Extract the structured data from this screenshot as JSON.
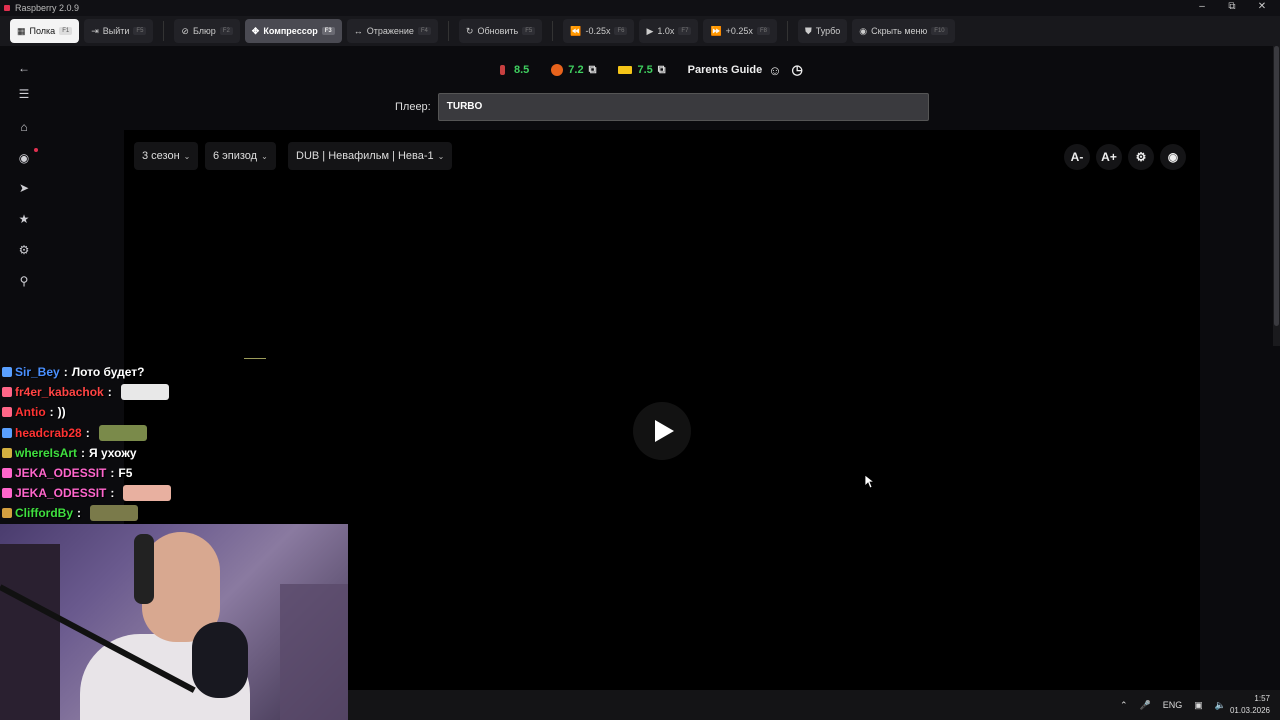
{
  "window": {
    "title": "Raspberry 2.0.9"
  },
  "toolbar": {
    "buttons": [
      {
        "label": "Полка",
        "key": "F1",
        "icon": "book-icon"
      },
      {
        "label": "Выйти",
        "key": "F5",
        "icon": "exit-icon"
      },
      {
        "label": "Блюр",
        "key": "F2",
        "icon": "blur-icon"
      },
      {
        "label": "Компрессор",
        "key": "F3",
        "icon": "compress-icon"
      },
      {
        "label": "Отражение",
        "key": "F4",
        "icon": "mirror-icon"
      },
      {
        "label": "Обновить",
        "key": "F5",
        "icon": "refresh-icon"
      },
      {
        "label": "-0.25x",
        "key": "F6",
        "icon": "rewind-icon"
      },
      {
        "label": "1.0x",
        "key": "F7",
        "icon": "play-icon"
      },
      {
        "label": "+0.25x",
        "key": "F8",
        "icon": "forward-icon"
      },
      {
        "label": "Турбо",
        "icon": "shield-icon"
      },
      {
        "label": "Скрыть меню",
        "key": "F10",
        "icon": "eye-icon"
      }
    ]
  },
  "ratings": {
    "kp": "8.5",
    "shikimori": "7.2",
    "imdb": "7.5",
    "parents_guide": "Parents Guide"
  },
  "player": {
    "label": "Плеер:",
    "value": "TURBO"
  },
  "video": {
    "season": "3 сезон",
    "episode": "6 эпизод",
    "dub": "DUB | Невафильм | Нева-1",
    "font_minus": "A-",
    "font_plus": "A+"
  },
  "chat": [
    {
      "user": "Sir_Bey",
      "color": "#4a90ff",
      "message": "Лото будет?",
      "badge": "#5aa0ff"
    },
    {
      "user": "fr4er_kabachok",
      "color": "#ff4444",
      "message": "",
      "badge": "#ff6688",
      "emote": "#e8e8e8"
    },
    {
      "user": "Antio",
      "color": "#ff3333",
      "message": "))",
      "badge": "#ff6688"
    },
    {
      "user": "headcrab28",
      "color": "#ff3333",
      "message": "",
      "badge": "#5aa0ff",
      "emote": "#7a8a4a"
    },
    {
      "user": "whereIsArt",
      "color": "#3fdf3f",
      "message": "Я ухожу",
      "badge": "#d4b040"
    },
    {
      "user": "JEKA_ODESSIT",
      "color": "#ff66cc",
      "message": "F5",
      "badge": "#ff66cc"
    },
    {
      "user": "JEKA_ODESSIT",
      "color": "#ff66cc",
      "message": "",
      "badge": "#ff66cc",
      "emote": "#e8b0a0"
    },
    {
      "user": "CliffordBy",
      "color": "#3fdf3f",
      "message": "",
      "badge": "#d4a040",
      "emote": "#7a7a4a"
    }
  ],
  "tray": {
    "lang": "ENG",
    "time": "1:57",
    "date": "01.03.2026"
  },
  "colors": {
    "accent": "#3fcf5f",
    "bg": "#0b0b0e"
  }
}
